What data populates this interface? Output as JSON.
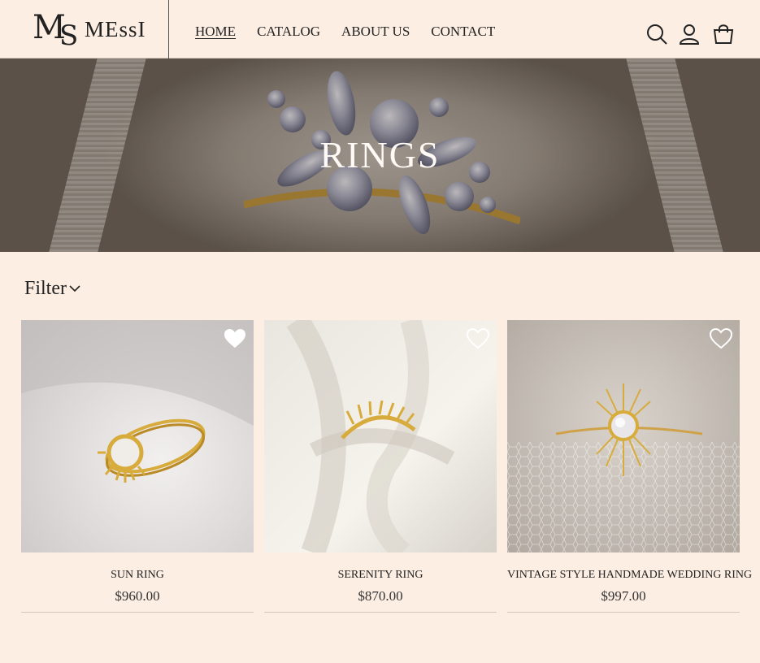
{
  "brand": {
    "name": "MEssI",
    "monogram": "MS"
  },
  "nav": [
    {
      "label": "HOME"
    },
    {
      "label": "CATALOG"
    },
    {
      "label": "ABOUT US"
    },
    {
      "label": "CONTACT"
    }
  ],
  "header_icons": [
    "search-icon",
    "user-icon",
    "shopping-bag-icon"
  ],
  "hero": {
    "title": "RINGS"
  },
  "filter": {
    "label": "Filter"
  },
  "products": [
    {
      "name": "SUN RING",
      "price": "$960.00",
      "favorited": true
    },
    {
      "name": "SERENITY RING",
      "price": "$870.00",
      "favorited": false
    },
    {
      "name": "VINTAGE STYLE HANDMADE WEDDING RING",
      "price": "$997.00",
      "favorited": false
    }
  ],
  "colors": {
    "background": "#fdeee3",
    "text": "#222222",
    "gold": "#d4a53a"
  }
}
